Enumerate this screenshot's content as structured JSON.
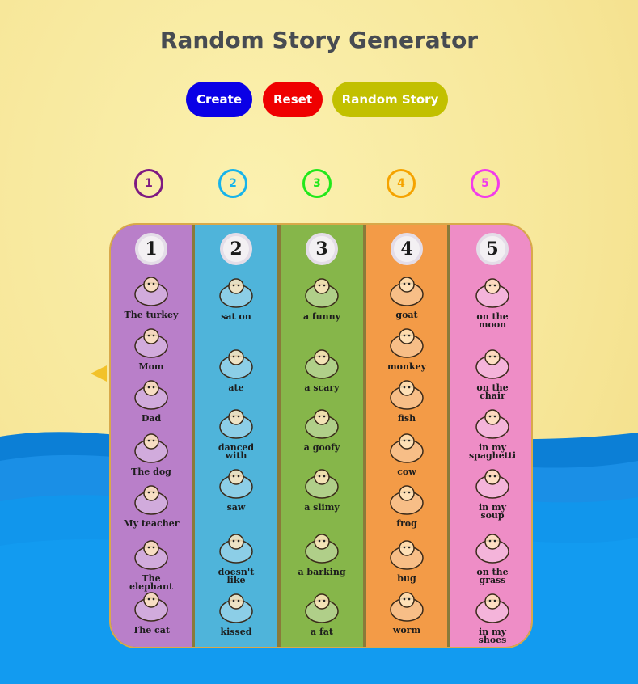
{
  "title": "Random Story Generator",
  "buttons": {
    "create": "Create",
    "reset": "Reset",
    "random": "Random Story"
  },
  "numbers": [
    {
      "label": "1",
      "color": "#7e1a82"
    },
    {
      "label": "2",
      "color": "#17b3ea"
    },
    {
      "label": "3",
      "color": "#22e81a"
    },
    {
      "label": "4",
      "color": "#f5a300"
    },
    {
      "label": "5",
      "color": "#f23cea"
    }
  ],
  "columns": [
    {
      "head": "1",
      "color": "#b97fc9",
      "items": [
        "The turkey",
        "Mom",
        "Dad",
        "The dog",
        "My teacher",
        "The\nelephant",
        "The cat"
      ]
    },
    {
      "head": "2",
      "color": "#4fb4da",
      "items": [
        "sat on",
        "ate",
        "danced\nwith",
        "saw",
        "doesn't\nlike",
        "kissed"
      ]
    },
    {
      "head": "3",
      "color": "#86b64a",
      "items": [
        "a funny",
        "a scary",
        "a goofy",
        "a slimy",
        "a barking",
        "a fat"
      ]
    },
    {
      "head": "4",
      "color": "#f39b47",
      "items": [
        "goat",
        "monkey",
        "fish",
        "cow",
        "frog",
        "bug",
        "worm"
      ]
    },
    {
      "head": "5",
      "color": "#ee8dc6",
      "items": [
        "on the\nmoon",
        "on the\nchair",
        "in my\nspaghetti",
        "in my\nsoup",
        "on the\ngrass",
        "in my\nshoes"
      ]
    }
  ]
}
